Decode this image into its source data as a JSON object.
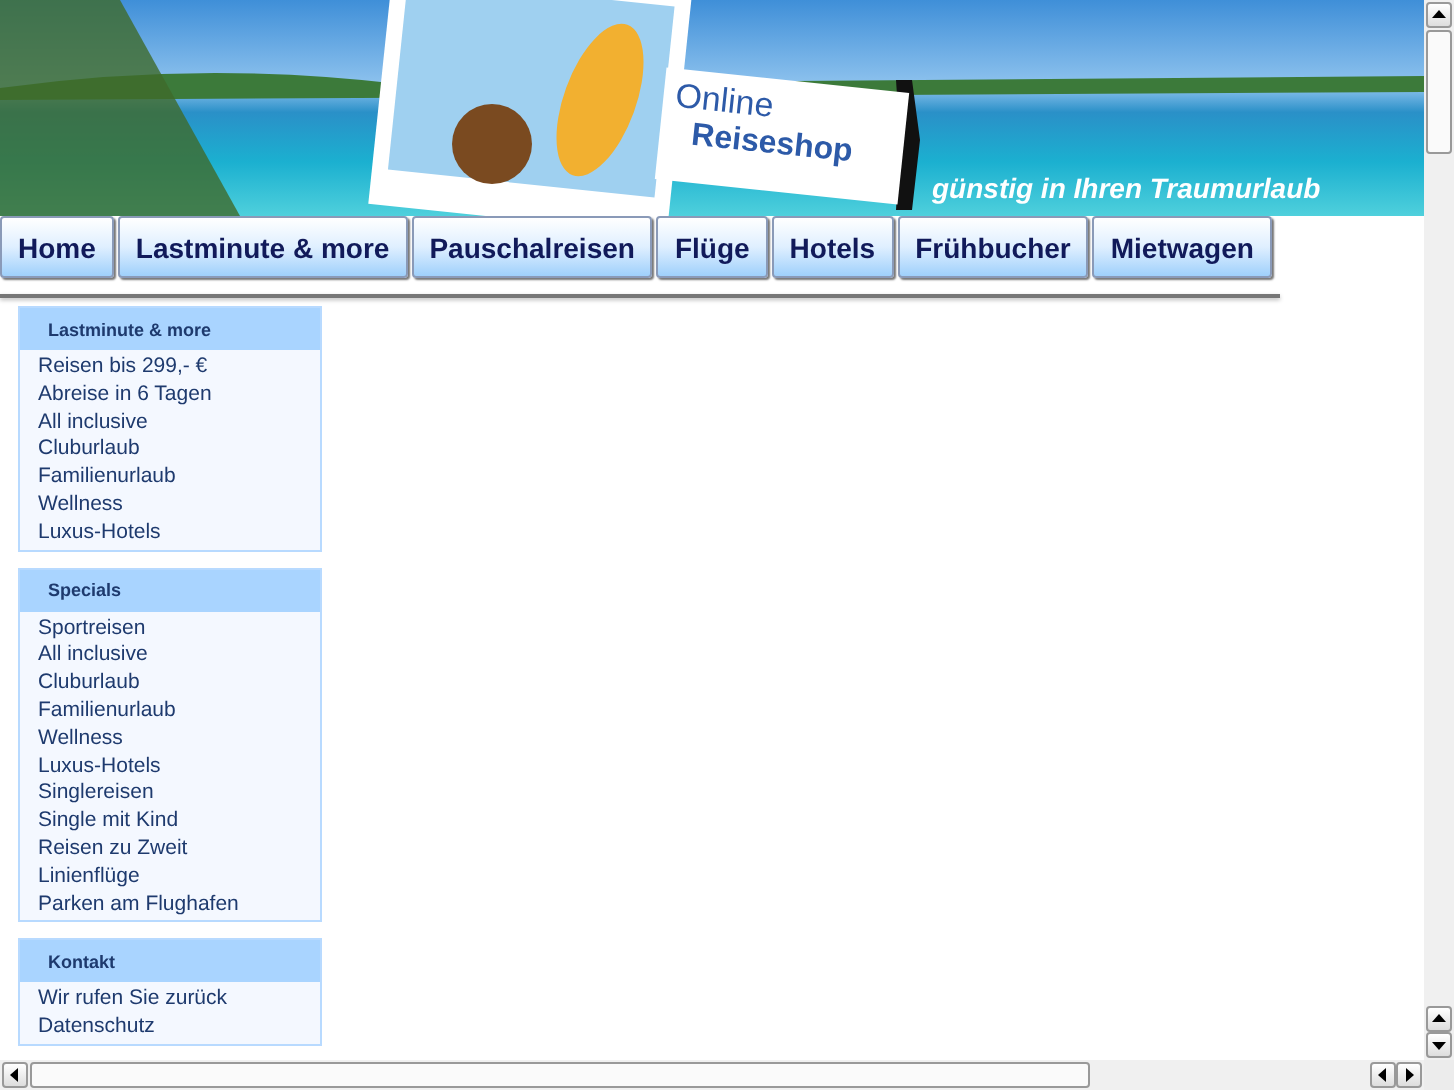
{
  "banner": {
    "logo_line_1": "Online",
    "logo_line_2": "Reiseshop",
    "slogan": "günstig in Ihren Traumurlaub"
  },
  "nav": [
    "Home",
    "Lastminute & more",
    "Pauschalreisen",
    "Flüge",
    "Hotels",
    "Frühbucher",
    "Mietwagen"
  ],
  "sidebar": [
    {
      "title": "Lastminute & more",
      "items": [
        "Reisen bis 299,- €",
        "Abreise in 6 Tagen",
        "All inclusive",
        "Cluburlaub",
        "Familienurlaub",
        "Wellness",
        "Luxus-Hotels"
      ]
    },
    {
      "title": "Specials",
      "items": [
        "Sportreisen",
        "All inclusive",
        "Cluburlaub",
        "Familienurlaub",
        "Wellness",
        "Luxus-Hotels",
        "Singlereisen",
        "Single mit Kind",
        "Reisen zu Zweit",
        "Linienflüge",
        "Parken am Flughafen"
      ]
    },
    {
      "title": "Kontakt",
      "items": [
        "Wir rufen Sie zurück",
        "Datenschutz"
      ]
    }
  ]
}
